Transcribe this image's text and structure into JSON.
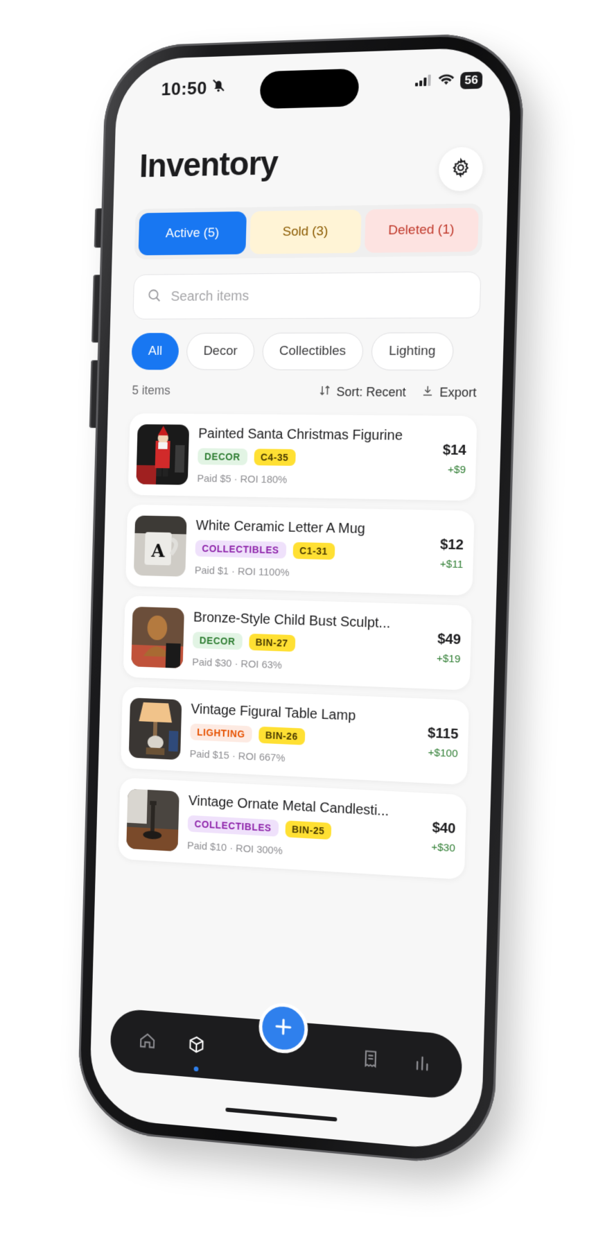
{
  "status": {
    "time": "10:50",
    "battery": "56"
  },
  "header": {
    "title": "Inventory"
  },
  "tabs": [
    {
      "label": "Active (5)"
    },
    {
      "label": "Sold (3)"
    },
    {
      "label": "Deleted (1)"
    }
  ],
  "search": {
    "placeholder": "Search items"
  },
  "filters": [
    {
      "label": "All",
      "selected": true
    },
    {
      "label": "Decor"
    },
    {
      "label": "Collectibles"
    },
    {
      "label": "Lighting"
    }
  ],
  "list": {
    "count": "5 items",
    "sort_label": "Sort: Recent",
    "export_label": "Export"
  },
  "items": [
    {
      "name": "Painted Santa Christmas Figurine",
      "category": "DECOR",
      "bin": "C4-35",
      "paid": "Paid $5 · ROI 180%",
      "price": "$14",
      "profit": "+$9"
    },
    {
      "name": "White Ceramic Letter A Mug",
      "category": "COLLECTIBLES",
      "bin": "C1-31",
      "paid": "Paid $1 · ROI 1100%",
      "price": "$12",
      "profit": "+$11"
    },
    {
      "name": "Bronze-Style Child Bust Sculpt...",
      "category": "DECOR",
      "bin": "BIN-27",
      "paid": "Paid $30 · ROI 63%",
      "price": "$49",
      "profit": "+$19"
    },
    {
      "name": "Vintage Figural Table Lamp",
      "category": "LIGHTING",
      "bin": "BIN-26",
      "paid": "Paid $15 · ROI 667%",
      "price": "$115",
      "profit": "+$100"
    },
    {
      "name": "Vintage Ornate Metal Candlesti...",
      "category": "COLLECTIBLES",
      "bin": "BIN-25",
      "paid": "Paid $10 · ROI 300%",
      "price": "$40",
      "profit": "+$30"
    }
  ],
  "nav": {
    "icons": [
      "home-icon",
      "box-icon",
      "plus-icon",
      "receipt-icon",
      "bar-chart-icon"
    ],
    "active": "box-icon"
  },
  "colors": {
    "accent": "#1877f2",
    "profit": "#2e7d32",
    "bin_tag": "#ffe033"
  }
}
